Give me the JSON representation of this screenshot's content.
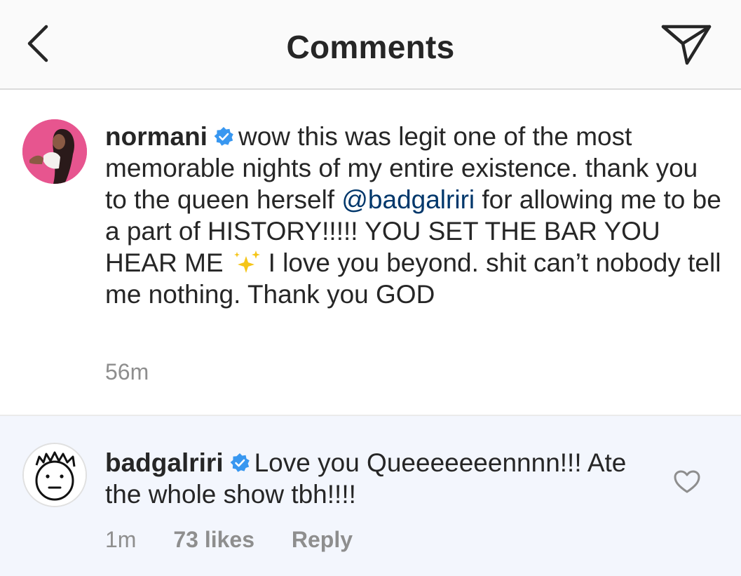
{
  "header": {
    "title": "Comments",
    "back_icon": "chevron-left-icon",
    "share_icon": "paper-plane-icon"
  },
  "caption": {
    "username": "normani",
    "text_before_mention": "wow this was legit one of the most memorable nights of my entire existence. thank you to the queen herself",
    "mention": "@badgalriri",
    "text_before_emoji": "for allowing me to be a part of HISTORY!!!!! YOU SET THE BAR YOU HEAR ME",
    "emoji": "sparkles-icon",
    "text_after_emoji": "I love you beyond. shit can’t nobody tell me nothing. Thank you GOD",
    "time": "56m"
  },
  "reply": {
    "username": "badgalriri",
    "text": "Love you Queeeeeeennnn!!! Ate the whole show tbh!!!!",
    "time": "1m",
    "likes": "73 likes",
    "reply_label": "Reply",
    "like_icon": "heart-outline-icon"
  },
  "colors": {
    "verified_blue": "#3897f0",
    "mention_blue": "#00376b",
    "meta_gray": "#8e8e8e",
    "reply_background": "#f3f6fd"
  }
}
